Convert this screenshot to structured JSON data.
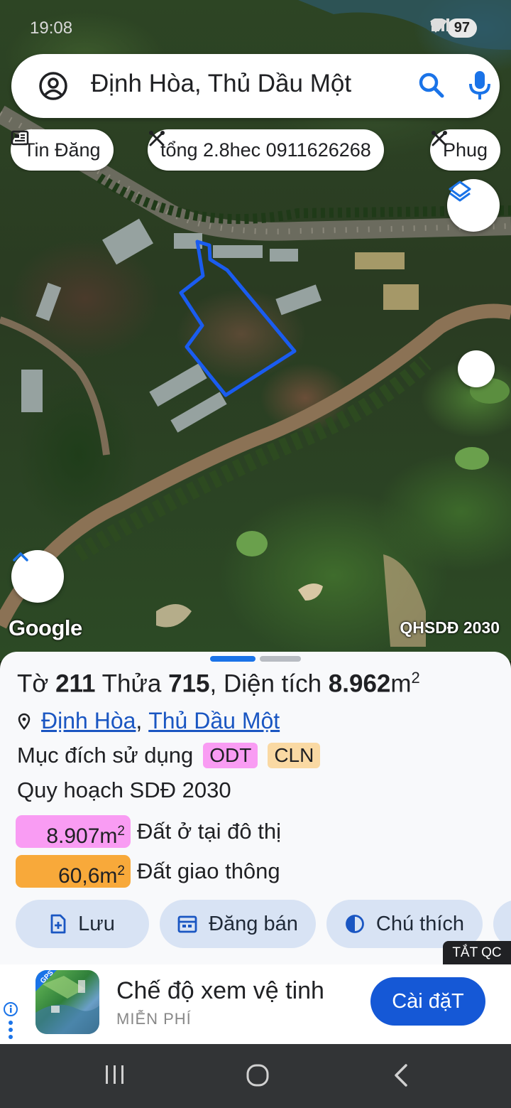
{
  "status_bar": {
    "time": "19:08",
    "battery": "97"
  },
  "search": {
    "query": "Định Hòa, Thủ Dầu Một"
  },
  "chips": [
    {
      "label": "Tin Đăng",
      "icon": "newspaper-icon"
    },
    {
      "label": "tổng 2.8hec 0911626268",
      "icon": "tool-icon"
    },
    {
      "label": "Phug",
      "icon": "tool-icon"
    }
  ],
  "map": {
    "logo": "Google",
    "overlay_label": "QHSDĐ 2030",
    "parcel_outline_color": "#1a5cf0"
  },
  "sheet": {
    "parcel": {
      "sheet_prefix": "Tờ ",
      "sheet_no": "211",
      "lot_prefix": " Thửa ",
      "lot_no": "715",
      "area_prefix": ", Diện tích ",
      "area_value": "8.962",
      "area_unit": "m",
      "area_sup": "2"
    },
    "location": {
      "ward": "Định Hòa",
      "separator": ",",
      "city": "Thủ Dầu Một"
    },
    "purpose": {
      "label": "Mục đích sử dụng",
      "tags": [
        "ODT",
        "CLN"
      ]
    },
    "plan_title": "Quy hoạch SDĐ 2030",
    "plan_areas": [
      {
        "value": "8.907m",
        "sup": "2",
        "label": "Đất ở tại đô thị",
        "color": "#f99cf3"
      },
      {
        "value": "60,6m",
        "sup": "2",
        "label": "Đất giao thông",
        "color": "#f8a93a"
      }
    ],
    "actions": [
      {
        "label": "Lưu",
        "icon": "bookmark-add-icon"
      },
      {
        "label": "Đăng bán",
        "icon": "calendar-icon"
      },
      {
        "label": "Chú thích",
        "icon": "contrast-icon"
      }
    ]
  },
  "ad": {
    "close_tag": "TẮT QC",
    "title": "Chế độ xem vệ tinh",
    "subtitle": "MIỄN PHÍ",
    "install_label": "Cài đặT",
    "app_badge": "GPS"
  },
  "colors": {
    "accent": "#1a73e8",
    "install_button": "#1558d6",
    "tag_odt": "#f99cf3",
    "tag_cln": "#fad9a3"
  }
}
